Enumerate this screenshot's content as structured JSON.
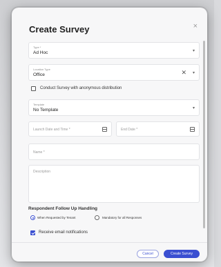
{
  "dialog": {
    "title": "Create Survey",
    "close_glyph": "×"
  },
  "type_field": {
    "label": "Type *",
    "value": "Ad Hoc"
  },
  "location_field": {
    "label": "Location Type",
    "value": "Office",
    "clear_glyph": "✕"
  },
  "anonymous": {
    "label": "Conduct Survey with anonymous distribution",
    "checked": false
  },
  "template_field": {
    "label": "Template",
    "value": "No Template"
  },
  "launch_field": {
    "placeholder": "Launch Date and Time *"
  },
  "end_field": {
    "placeholder": "End Date *"
  },
  "name_field": {
    "placeholder": "Name *"
  },
  "description_field": {
    "placeholder": "Description"
  },
  "followup": {
    "heading": "Respondent Follow Up Handling",
    "options": [
      {
        "label": "When Requested by Tenant",
        "selected": true
      },
      {
        "label": "Mandatory for all Responses",
        "selected": false
      }
    ]
  },
  "notifications": {
    "label": "Receive email notifications",
    "checked": true
  },
  "footer": {
    "cancel_label": "Cancel",
    "create_label": "Create Survey"
  },
  "colors": {
    "accent": "#3a4fd1"
  },
  "icons": {
    "caret": "chevron-down-icon",
    "calendar": "calendar-icon",
    "close": "close-icon"
  }
}
